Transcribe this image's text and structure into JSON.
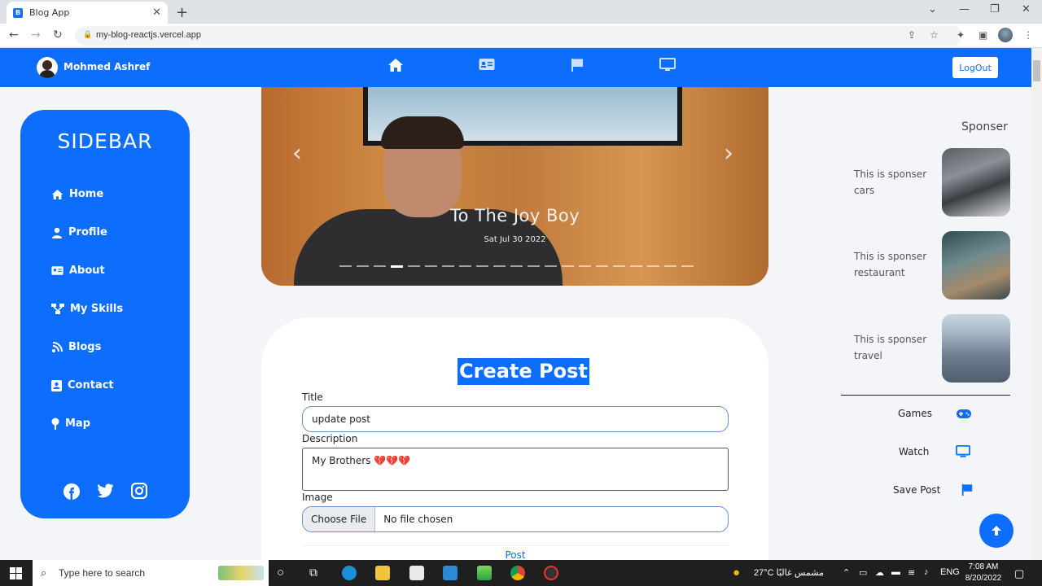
{
  "browser": {
    "tab_title": "Blog App",
    "url": "my-blog-reactjs.vercel.app"
  },
  "navbar": {
    "username": "Mohmed Ashref",
    "logout_label": "LogOut",
    "icons": [
      "home-icon",
      "id-card-icon",
      "flag-icon",
      "monitor-icon"
    ]
  },
  "sidebar": {
    "title": "SIDEBAR",
    "items": [
      {
        "label": "Home",
        "icon": "home-icon"
      },
      {
        "label": "Profile",
        "icon": "user-icon"
      },
      {
        "label": "About",
        "icon": "id-card-icon"
      },
      {
        "label": "My Skills",
        "icon": "sitemap-icon"
      },
      {
        "label": "Blogs",
        "icon": "blog-icon"
      },
      {
        "label": "Contact",
        "icon": "contact-icon"
      },
      {
        "label": "Map",
        "icon": "map-pin-icon"
      }
    ],
    "social": [
      "facebook-icon",
      "twitter-icon",
      "instagram-icon"
    ]
  },
  "carousel": {
    "caption_title": "To The Joy Boy",
    "caption_date": "Sat Jul 30 2022",
    "indicator_count": 21,
    "active_index": 3
  },
  "create_post": {
    "heading": "Create Post",
    "title_label": "Title",
    "title_value": "update post",
    "description_label": "Description",
    "description_value": "My Brothers 💔💔💔",
    "image_label": "Image",
    "choose_file_label": "Choose File",
    "no_file_text": "No file chosen",
    "post_label": "Post"
  },
  "sponsors": {
    "title": "Sponser",
    "items": [
      {
        "text": "This is sponser cars",
        "image": "cars"
      },
      {
        "text": "This is sponser restaurant",
        "image": "restaurant"
      },
      {
        "text": "This is sponser travel",
        "image": "travel"
      }
    ]
  },
  "right_links": [
    {
      "label": "Games",
      "icon": "gamepad-icon"
    },
    {
      "label": "Watch",
      "icon": "monitor-icon"
    },
    {
      "label": "Save Post",
      "icon": "flag-icon"
    }
  ],
  "taskbar": {
    "search_placeholder": "Type here to search",
    "weather": "27°C مشمس غالبًا",
    "language": "ENG",
    "time": "7:08 AM",
    "date": "8/20/2022"
  },
  "colors": {
    "primary": "#0d6efd",
    "page_bg": "#f3f5f8"
  }
}
